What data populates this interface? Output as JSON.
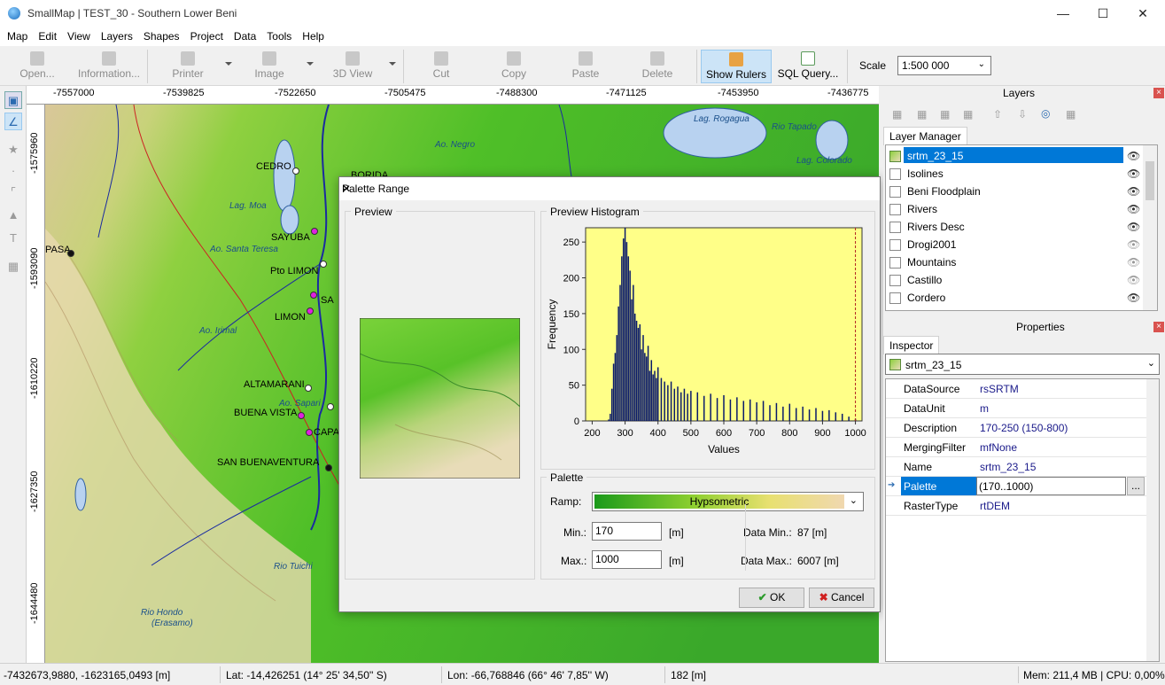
{
  "window": {
    "title": "SmallMap | TEST_30 - Southern Lower Beni",
    "minimize": "—",
    "maximize": "☐",
    "close": "✕"
  },
  "menu": [
    "Map",
    "Edit",
    "View",
    "Layers",
    "Shapes",
    "Project",
    "Data",
    "Tools",
    "Help"
  ],
  "toolbar": {
    "open": "Open...",
    "information": "Information...",
    "printer": "Printer",
    "image": "Image",
    "view3d": "3D View",
    "cut": "Cut",
    "copy": "Copy",
    "paste": "Paste",
    "delete": "Delete",
    "show_rulers": "Show Rulers",
    "sql_query": "SQL Query...",
    "scale_label": "Scale",
    "scale_value": "1:500 000"
  },
  "ruler": {
    "top": [
      "-7557000",
      "-7539825",
      "-7522650",
      "-7505475",
      "-7488300",
      "-7471125",
      "-7453950",
      "-7436775"
    ],
    "left": [
      "-1575960",
      "-1593090",
      "-1610220",
      "-1627350",
      "-1644480"
    ]
  },
  "map_labels": {
    "water": [
      "Lag. Rogagua",
      "Lag. Colorado",
      "Lag. Moa",
      "Ao. Santa Teresa",
      "Ao. Irimal",
      "Ao. Sapari",
      "Rio Tuichi",
      "Rio Hondo",
      "(Erasamo)",
      "Ao. Negro",
      "Rio Tapado"
    ],
    "towns": [
      "CEDRO",
      "SAYUBA",
      "Pto LIMON",
      "LIMON",
      "ALTAMARANI",
      "BUENA VISTA",
      "SAN BUENAVENTURA",
      "PASA",
      "CAPA",
      "SA",
      "BORIDA"
    ]
  },
  "dialog": {
    "title": "Palette Range",
    "close": "✕",
    "preview_label": "Preview",
    "histogram_label": "Preview Histogram",
    "palette_label": "Palette",
    "ramp_label": "Ramp:",
    "ramp_value": "Hypsometric",
    "min_label": "Min.:",
    "min_value": "170",
    "min_unit": "[m]",
    "max_label": "Max.:",
    "max_value": "1000",
    "max_unit": "[m]",
    "data_min_label": "Data Min.:",
    "data_min_value": "87 [m]",
    "data_max_label": "Data Max.:",
    "data_max_value": "6007 [m]",
    "ok": "OK",
    "cancel": "Cancel"
  },
  "chart_data": {
    "type": "bar",
    "xlabel": "Values",
    "ylabel": "Frequency",
    "xlim": [
      180,
      1020
    ],
    "ylim": [
      0,
      270
    ],
    "xticks": [
      200,
      300,
      400,
      500,
      600,
      700,
      800,
      900,
      1000
    ],
    "yticks": [
      0,
      50,
      100,
      150,
      200,
      250
    ],
    "marker_lines": [
      170,
      1000
    ],
    "background": "#ffff88",
    "bar_color": "#0a1a6a",
    "x": [
      250,
      255,
      260,
      265,
      270,
      275,
      280,
      285,
      290,
      295,
      300,
      305,
      310,
      315,
      320,
      325,
      330,
      335,
      340,
      345,
      350,
      355,
      360,
      365,
      370,
      375,
      380,
      385,
      390,
      395,
      400,
      410,
      420,
      430,
      440,
      450,
      460,
      470,
      480,
      490,
      500,
      520,
      540,
      560,
      580,
      600,
      620,
      640,
      660,
      680,
      700,
      720,
      740,
      760,
      780,
      800,
      820,
      840,
      860,
      880,
      900,
      920,
      940,
      960,
      980,
      1000
    ],
    "values": [
      2,
      10,
      45,
      80,
      95,
      120,
      160,
      190,
      230,
      255,
      270,
      250,
      230,
      210,
      170,
      190,
      150,
      140,
      130,
      135,
      100,
      120,
      95,
      90,
      105,
      70,
      85,
      65,
      70,
      60,
      75,
      60,
      55,
      50,
      55,
      45,
      48,
      40,
      45,
      38,
      42,
      40,
      35,
      38,
      32,
      36,
      30,
      33,
      28,
      30,
      26,
      28,
      22,
      25,
      20,
      24,
      18,
      20,
      16,
      18,
      14,
      15,
      12,
      10,
      6,
      3
    ]
  },
  "right": {
    "layers_title": "Layers",
    "layer_manager_tab": "Layer Manager",
    "layers": [
      "srtm_23_15",
      "Isolines",
      "Beni Floodplain",
      "Rivers",
      "Rivers Desc",
      "Drogi2001",
      "Mountains",
      "Castillo",
      "Cordero"
    ],
    "properties_title": "Properties",
    "inspector_tab": "Inspector",
    "inspector_object": "srtm_23_15",
    "properties": [
      {
        "k": "DataSource",
        "v": "rsSRTM"
      },
      {
        "k": "DataUnit",
        "v": "m"
      },
      {
        "k": "Description",
        "v": "170-250 (150-800)"
      },
      {
        "k": "MergingFilter",
        "v": "mfNone"
      },
      {
        "k": "Name",
        "v": "srtm_23_15"
      },
      {
        "k": "Palette",
        "v": "(170..1000)"
      },
      {
        "k": "RasterType",
        "v": "rtDEM"
      }
    ],
    "ellipsis": "..."
  },
  "status": {
    "coords": "-7432673,9880, -1623165,0493 [m]",
    "lat": "Lat: -14,426251 (14° 25' 34,50'' S)",
    "lon": "Lon: -66,768846 (66° 46' 7,85'' W)",
    "elev": "182 [m]",
    "mem": "Mem: 211,4 MB | CPU: 0,00%"
  }
}
